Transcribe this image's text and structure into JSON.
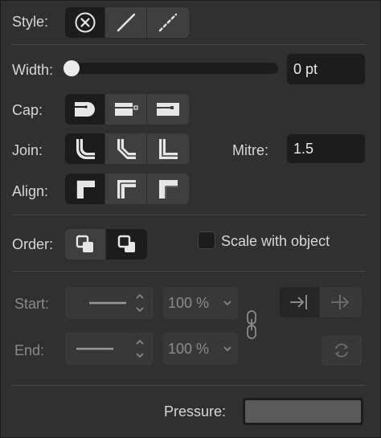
{
  "style": {
    "label": "Style:",
    "options": [
      {
        "icon": "none-icon",
        "selected": true
      },
      {
        "icon": "solid-line-icon",
        "selected": false
      },
      {
        "icon": "dashed-line-icon",
        "selected": false
      }
    ]
  },
  "width": {
    "label": "Width:",
    "value": "0 pt",
    "slider_fraction": 0
  },
  "cap": {
    "label": "Cap:",
    "options": [
      {
        "icon": "round-cap-icon",
        "selected": true
      },
      {
        "icon": "butt-cap-icon",
        "selected": false
      },
      {
        "icon": "square-cap-icon",
        "selected": false
      }
    ]
  },
  "join": {
    "label": "Join:",
    "options": [
      {
        "icon": "round-join-icon",
        "selected": true
      },
      {
        "icon": "bevel-join-icon",
        "selected": false
      },
      {
        "icon": "mitre-join-icon",
        "selected": false
      }
    ]
  },
  "mitre": {
    "label": "Mitre:",
    "value": "1.5"
  },
  "align": {
    "label": "Align:",
    "options": [
      {
        "icon": "align-inside-icon",
        "selected": true
      },
      {
        "icon": "align-center-icon",
        "selected": false
      },
      {
        "icon": "align-outside-icon",
        "selected": false
      }
    ]
  },
  "order": {
    "label": "Order:",
    "options": [
      {
        "icon": "stroke-behind-fill-icon",
        "selected": false
      },
      {
        "icon": "stroke-in-front-icon",
        "selected": true
      }
    ]
  },
  "scale": {
    "label": "Scale with object",
    "checked": false
  },
  "start": {
    "label": "Start:",
    "percent": "100 %"
  },
  "end": {
    "label": "End:",
    "percent": "100 %"
  },
  "pressure": {
    "label": "Pressure:"
  }
}
